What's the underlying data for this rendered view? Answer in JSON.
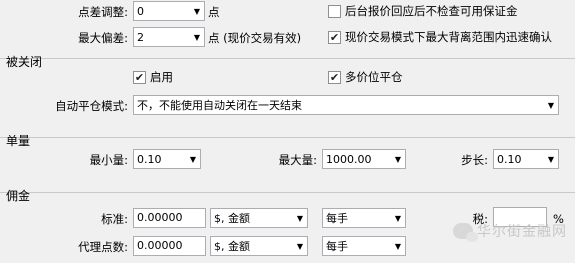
{
  "top": {
    "slippage_label": "点差调整:",
    "slippage_value": "0",
    "slippage_unit": "点",
    "max_deviation_label": "最大偏差:",
    "max_deviation_value": "2",
    "max_deviation_unit": "点 (现价交易有效)",
    "cb_no_margin_check_label": "后台报价回应后不检查可用保证金",
    "cb_no_margin_check_checked": false,
    "cb_reject_deviation_label": "现价交易模式下最大背离范围内迅速确认",
    "cb_reject_deviation_checked": true
  },
  "closed_by": {
    "title": "被关闭",
    "enable_label": "启用",
    "enable_checked": true,
    "multi_close_label": "多价位平仓",
    "multi_close_checked": true,
    "auto_close_label": "自动平仓模式:",
    "auto_close_value": "不，不能使用自动关闭在一天结束"
  },
  "volume": {
    "title": "单量",
    "min_label": "最小量:",
    "min_value": "0.10",
    "max_label": "最大量:",
    "max_value": "1000.00",
    "step_label": "步长:",
    "step_value": "0.10"
  },
  "commission": {
    "title": "佣金",
    "standard_label": "标准:",
    "standard_value": "0.00000",
    "standard_type": "$, 金额",
    "standard_per": "每手",
    "tax_label": "税:",
    "tax_value": "",
    "tax_unit": "%",
    "agent_label": "代理点数:",
    "agent_value": "0.00000",
    "agent_type": "$, 金额",
    "agent_per": "每手"
  },
  "watermark": {
    "text": "华尔街金融网"
  },
  "icons": {
    "dropdown": "chevron-down-icon",
    "check": "checkmark-icon",
    "watermark": "wechat-icon"
  }
}
